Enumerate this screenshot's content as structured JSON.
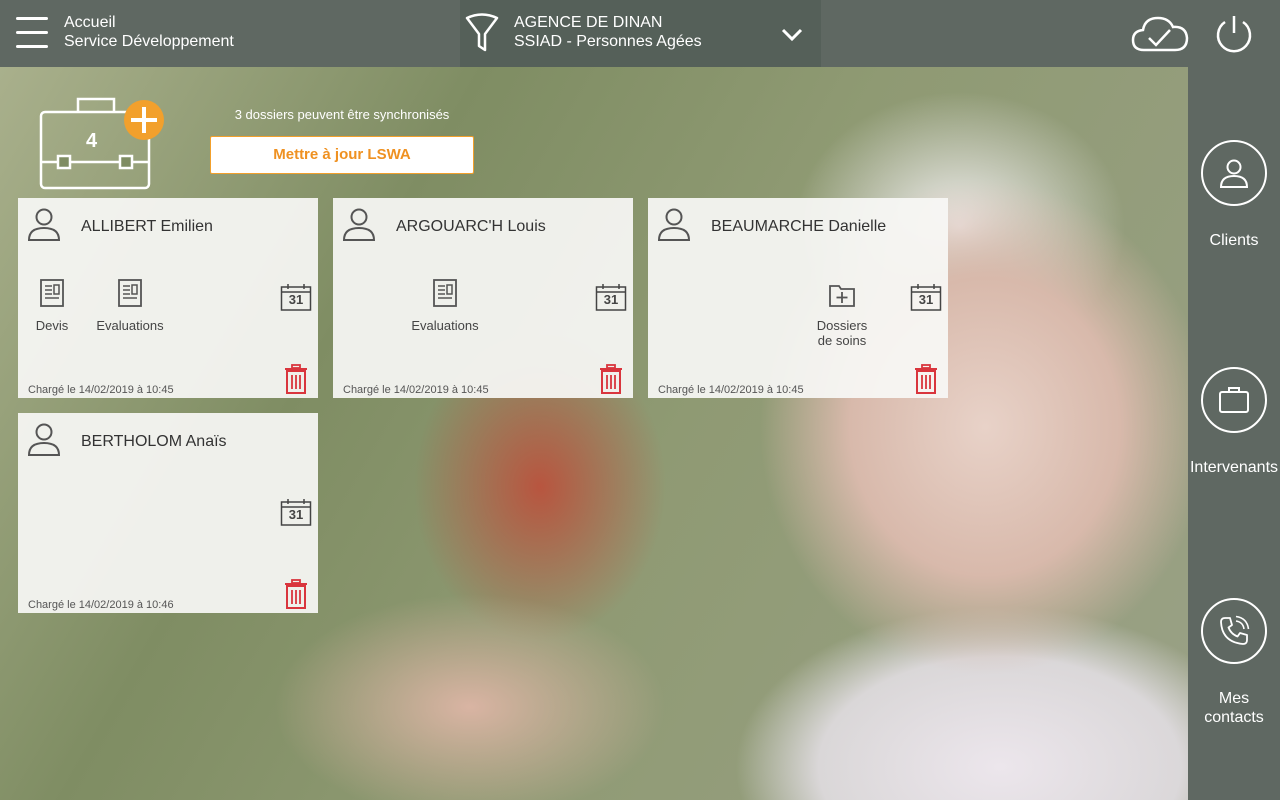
{
  "topbar": {
    "crumb_line1": "Accueil",
    "crumb_line2": "Service Développement",
    "agency_line1": "AGENCE DE DINAN",
    "agency_line2": "SSIAD - Personnes Agées"
  },
  "sync": {
    "count": "4",
    "message": "3 dossiers peuvent être synchronisés",
    "button_label": "Mettre à jour LSWA"
  },
  "cards": [
    {
      "name": "ALLIBERT Emilien",
      "docs": [
        "Devis",
        "Evaluations"
      ],
      "loaded": "Chargé le 14/02/2019 à 10:45",
      "calendar_day": "31"
    },
    {
      "name": "ARGOUARC'H Louis",
      "docs": [
        "Evaluations"
      ],
      "loaded": "Chargé le 14/02/2019 à 10:45",
      "calendar_day": "31"
    },
    {
      "name": "BEAUMARCHE Danielle",
      "docs": [
        "Dossiers de soins"
      ],
      "loaded": "Chargé le 14/02/2019 à 10:45",
      "calendar_day": "31"
    },
    {
      "name": "BERTHOLOM Anaïs",
      "docs": [],
      "loaded": "Chargé le 14/02/2019 à 10:46",
      "calendar_day": "31"
    }
  ],
  "sidebar": {
    "items": [
      {
        "label": "Clients",
        "icon": "user-icon"
      },
      {
        "label": "Intervenants",
        "icon": "briefcase-icon"
      },
      {
        "label": "Mes contacts",
        "icon": "phone-icon"
      }
    ]
  },
  "colors": {
    "bar": "#5f6862",
    "accent_orange": "#f2a02c",
    "trash_red": "#d9353d"
  }
}
